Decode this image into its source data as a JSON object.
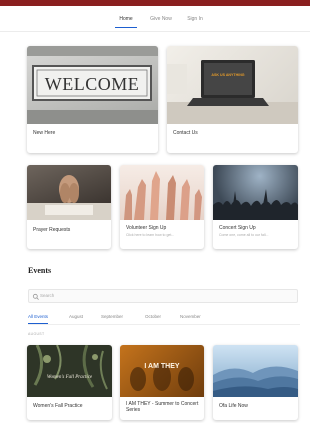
{
  "nav": {
    "tabs": [
      {
        "label": "Home",
        "active": true
      },
      {
        "label": "Give Now",
        "active": false
      },
      {
        "label": "Sign In",
        "active": false
      }
    ]
  },
  "featured": [
    {
      "title": "New Here",
      "image_text": "WELCOME"
    },
    {
      "title": "Contact Us",
      "image_text": "ASK US ANYTHING"
    }
  ],
  "signups": [
    {
      "title": "Prayer Requests",
      "subtitle": ""
    },
    {
      "title": "Volunteer Sign Up",
      "subtitle": "Click here to learn how to get..."
    },
    {
      "title": "Concert Sign Up",
      "subtitle": "Come one, come all to our fall..."
    }
  ],
  "events": {
    "heading": "Events",
    "search_placeholder": "Search",
    "filters": [
      {
        "label": "All Events",
        "active": true
      },
      {
        "label": "August",
        "active": false
      },
      {
        "label": "September",
        "active": false
      },
      {
        "label": "October",
        "active": false
      },
      {
        "label": "November",
        "active": false
      }
    ],
    "month_label": "AUGUST",
    "items": [
      {
        "title": "Women's Fall Practice",
        "image_text": "Women's Fall Practice"
      },
      {
        "title": "I AM THEY - Summer to Concert Series",
        "image_text": "I AM THEY"
      },
      {
        "title": "Ofa Life Now",
        "image_text": ""
      }
    ]
  },
  "colors": {
    "accent": "#1d5fd0",
    "topbar": "#8a1f1f"
  }
}
